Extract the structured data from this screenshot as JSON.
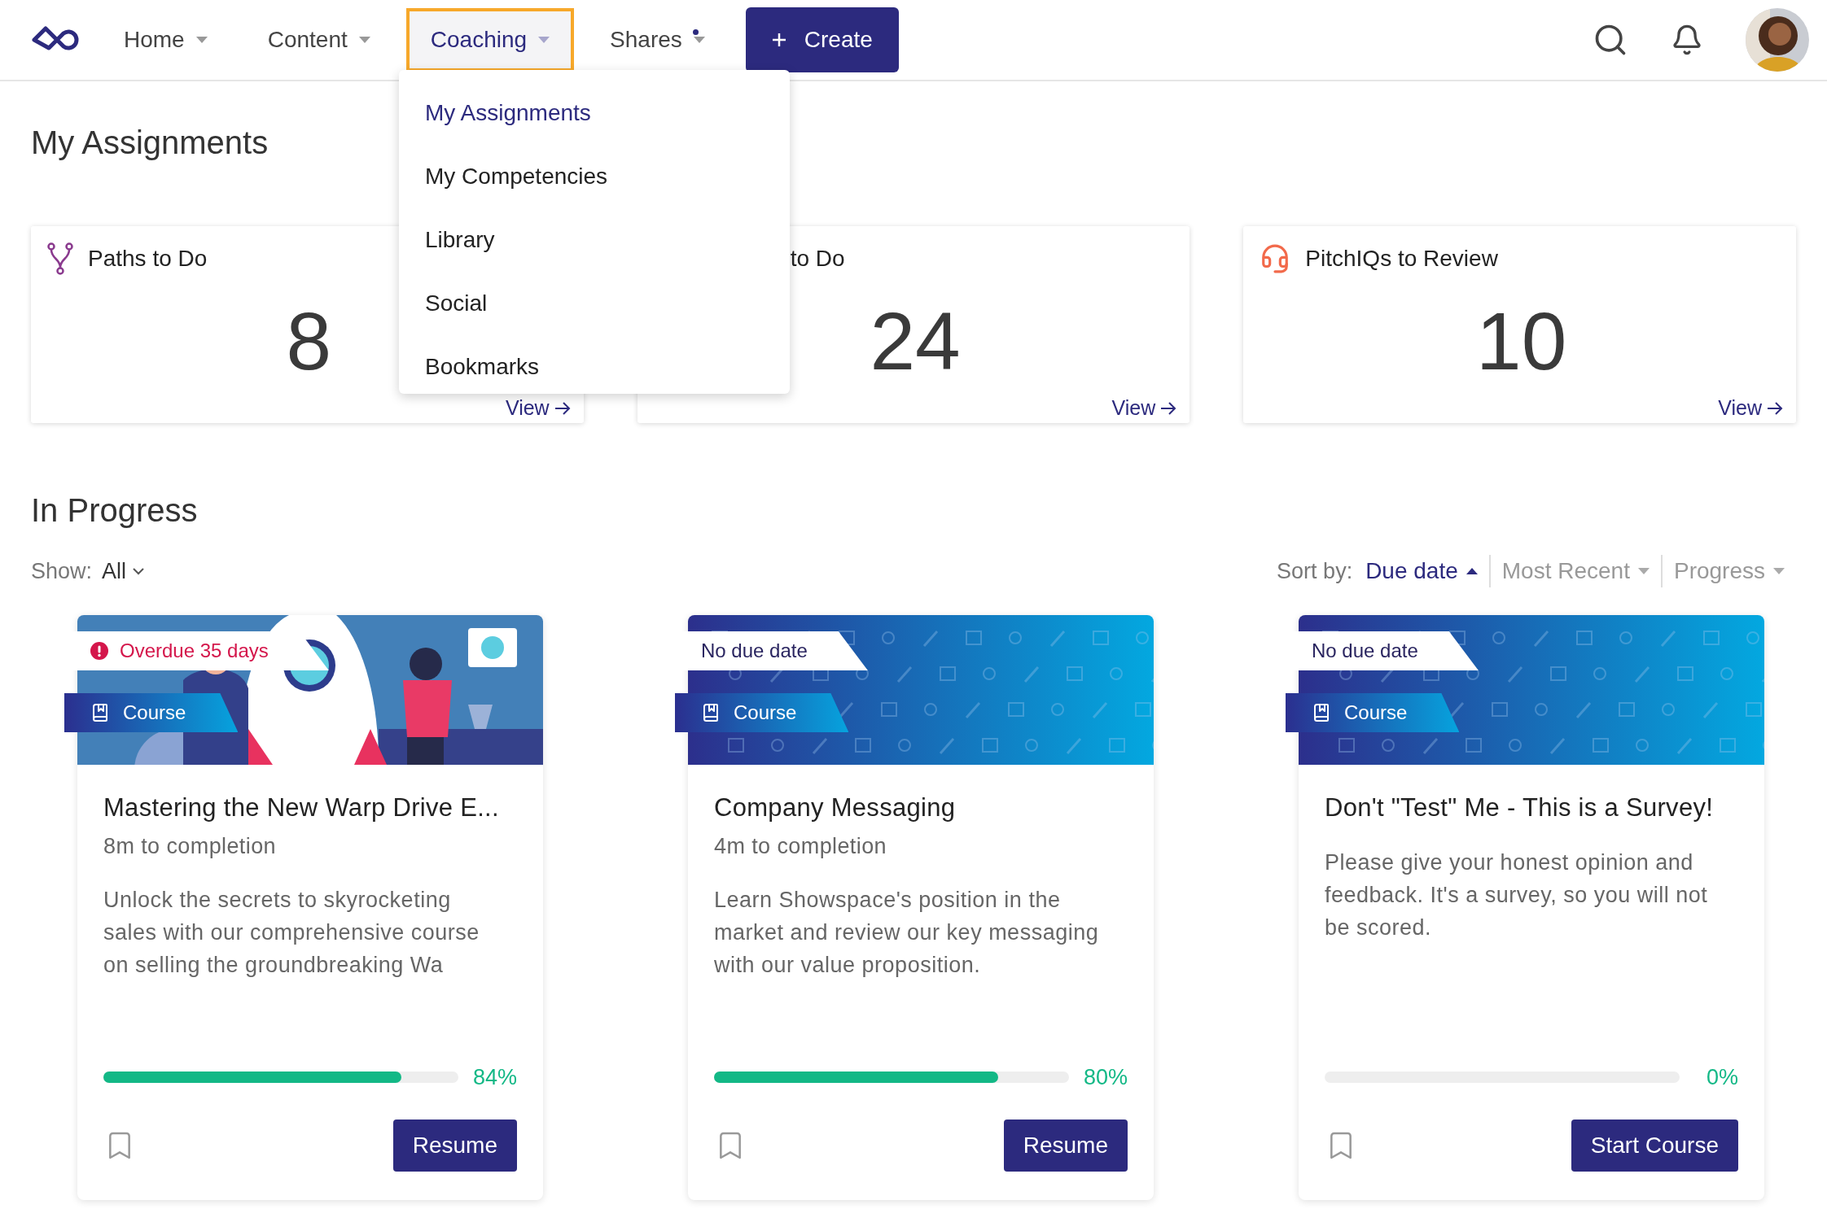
{
  "nav": {
    "items": [
      {
        "label": "Home",
        "selected": false,
        "dot": false
      },
      {
        "label": "Content",
        "selected": false,
        "dot": false
      },
      {
        "label": "Coaching",
        "selected": true,
        "dot": false
      },
      {
        "label": "Shares",
        "selected": false,
        "dot": true
      }
    ],
    "create_button": "Create"
  },
  "dropdown": {
    "items": [
      {
        "label": "My Assignments",
        "selected": true
      },
      {
        "label": "My Competencies",
        "selected": false
      },
      {
        "label": "Library",
        "selected": false
      },
      {
        "label": "Social",
        "selected": false
      },
      {
        "label": "Bookmarks",
        "selected": false
      }
    ]
  },
  "assignments": {
    "title": "My Assignments",
    "cards": [
      {
        "kind": "paths",
        "title": "Paths to Do",
        "count": "8",
        "link": "View"
      },
      {
        "kind": "covered",
        "title": "to Do",
        "count": "24",
        "link": "View"
      },
      {
        "kind": "pitchiq",
        "title": "PitchIQs to Review",
        "count": "10",
        "link": "View"
      }
    ]
  },
  "in_progress": {
    "title": "In Progress",
    "show_label": "Show:",
    "show_value": "All",
    "sort_label": "Sort by:",
    "sort_options": [
      {
        "label": "Due date",
        "selected": true
      },
      {
        "label": "Most Recent",
        "selected": false
      },
      {
        "label": "Progress",
        "selected": false
      }
    ],
    "courses": [
      {
        "due": {
          "kind": "overdue",
          "label": "Overdue 35 days"
        },
        "type": "Course",
        "title": "Mastering the New Warp Drive E...",
        "duration": "8m to completion",
        "description": "Unlock the secrets to skyrocketing sales with our comprehensive course on selling the groundbreaking Wa",
        "level": 0.84,
        "percent": "84%",
        "button": "Resume"
      },
      {
        "due": {
          "kind": "none",
          "label": "No due date"
        },
        "type": "Course",
        "title": "Company Messaging",
        "duration": "4m to completion",
        "description": "Learn Showspace's position in the market and review our key messaging with our value proposition.",
        "level": 0.8,
        "percent": "80%",
        "button": "Resume"
      },
      {
        "due": {
          "kind": "none",
          "label": "No due date"
        },
        "type": "Course",
        "title": "Don't \"Test\" Me - This is a Survey!",
        "description": "Please give your honest opinion and feedback. It's a survey, so you will not be scored.",
        "level": 0,
        "percent": "0%",
        "button": "Start Course"
      }
    ]
  }
}
